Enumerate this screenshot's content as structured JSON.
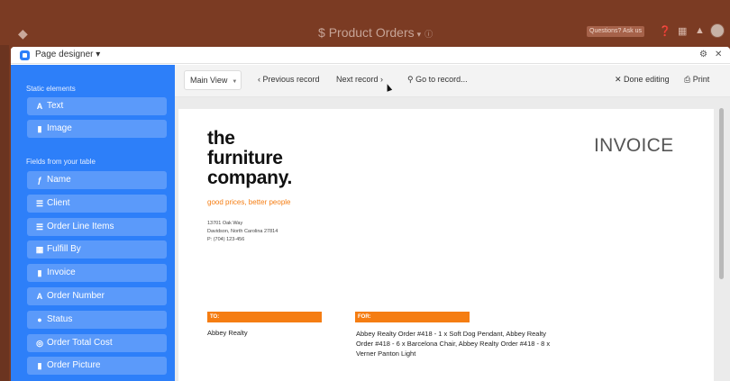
{
  "app": {
    "title": "Product Orders",
    "title_caret": "▾",
    "help_label": "Questions? Ask us"
  },
  "modal": {
    "label": "Page designer ▾"
  },
  "sidebar": {
    "static_heading": "Static elements",
    "static_items": [
      {
        "icon": "A",
        "label": "Text"
      },
      {
        "icon": "▮",
        "label": "Image"
      }
    ],
    "fields_heading": "Fields from your table",
    "field_items": [
      {
        "icon": "ƒ",
        "label": "Name"
      },
      {
        "icon": "☰",
        "label": "Client"
      },
      {
        "icon": "☰",
        "label": "Order Line Items"
      },
      {
        "icon": "▦",
        "label": "Fulfill By"
      },
      {
        "icon": "▮",
        "label": "Invoice"
      },
      {
        "icon": "A",
        "label": "Order Number"
      },
      {
        "icon": "●",
        "label": "Status"
      },
      {
        "icon": "◎",
        "label": "Order Total Cost"
      },
      {
        "icon": "▮",
        "label": "Order Picture"
      }
    ]
  },
  "toolbar": {
    "view_label": "Main View",
    "prev_label": "Previous record",
    "next_label": "Next record",
    "goto_label": "Go to record...",
    "done_label": "Done editing",
    "print_label": "Print"
  },
  "invoice": {
    "brand_line1": "the",
    "brand_line2": "furniture",
    "brand_line3": "company.",
    "tagline": "good prices, better people",
    "address_line1": "13701 Oak Way",
    "address_line2": "Davidson, North Carolina 27814",
    "address_line3": "P: (704) 123-456",
    "title": "INVOICE",
    "to_label": "TO:",
    "to_value": "Abbey Realty",
    "for_label": "FOR:",
    "for_value": "Abbey Realty Order #418 - 1 x Soft Dog Pendant, Abbey Realty Order #418 - 6 x Barcelona Chair, Abbey Realty Order #418 - 8 x Verner Panton Light"
  },
  "colors": {
    "accent": "#2d7ff9",
    "brand_orange": "#f57d12",
    "appbar": "#7b3b23"
  }
}
